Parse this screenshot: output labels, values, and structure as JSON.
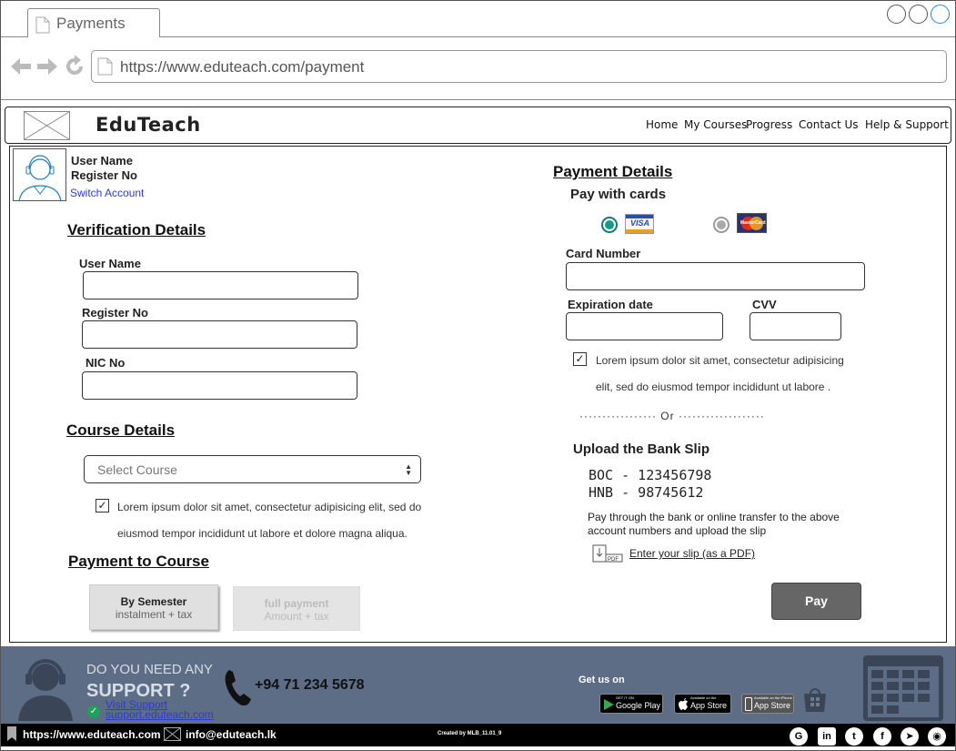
{
  "browser": {
    "tab_title": "Payments",
    "url": "https://www.eduteach.com/payment"
  },
  "header": {
    "brand": "EduTeach",
    "nav": [
      "Home",
      "My Courses",
      "Progress",
      "Contact Us",
      "Help & Support"
    ]
  },
  "user": {
    "name": "User Name",
    "register_no": "Register No",
    "switch_account": "Switch Account"
  },
  "verification": {
    "title": "Verification Details",
    "fields": [
      {
        "label": "User Name",
        "value": ""
      },
      {
        "label": "Register No",
        "value": ""
      },
      {
        "label": "NIC No",
        "value": ""
      }
    ]
  },
  "course": {
    "title": "Course Details",
    "select_value": "Select Course",
    "agree_line1": "Lorem ipsum dolor sit amet, consectetur adipisicing elit, sed do",
    "agree_line2": "eiusmod tempor incididunt ut labore et dolore magna aliqua.",
    "agree_checked": true
  },
  "payment_to_course": {
    "title": "Payment to Course",
    "semester": {
      "title": "By Semester",
      "sub": "instalment + tax"
    },
    "full": {
      "title": "full payment",
      "sub": "Amount + tax"
    }
  },
  "payment_details": {
    "title": "Payment Details",
    "pay_with_cards": "Pay with cards",
    "selected_card": "VISA",
    "visa_label": "VISA",
    "mastercard_label": "MasterCard",
    "card_number_label": "Card Number",
    "expiration_label": "Expiration date",
    "cvv_label": "CVV",
    "agree_line1": "Lorem ipsum dolor sit amet, consectetur adipisicing",
    "agree_line2": "elit, sed do eiusmod tempor incididunt ut labore .",
    "agree_checked": true,
    "or_divider": "Or"
  },
  "bank_slip": {
    "title": "Upload the Bank Slip",
    "accounts": [
      "BOC - 123456798",
      "HNB - 98745612"
    ],
    "note_line1": "Pay through the bank or online transfer to the above",
    "note_line2": "account numbers and upload the slip",
    "upload_link": "Enter your slip (as a PDF)",
    "pdf_icon_text": "PDF",
    "pay_button": "Pay"
  },
  "footer": {
    "support_line1": "DO YOU NEED ANY",
    "support_line2": "SUPPORT ?",
    "visit_support": "Visit Support",
    "support_url": "support.eduteach.com",
    "phone": "+94 71 234 5678",
    "get_us_on": "Get us on",
    "stores": [
      {
        "top": "GET IT ON",
        "name": "Google Play"
      },
      {
        "top": "Available on the",
        "name": "App Store"
      },
      {
        "top": "Available on the iPhone",
        "name": "App Store"
      }
    ],
    "site_url": "https://www.eduteach.com",
    "email": "info@eduteach.lk",
    "credit": "Created by MLB_11.01_9",
    "social_icons": [
      "google-icon",
      "linkedin-icon",
      "twitter-icon",
      "facebook-icon",
      "telegram-icon",
      "github-icon"
    ]
  }
}
